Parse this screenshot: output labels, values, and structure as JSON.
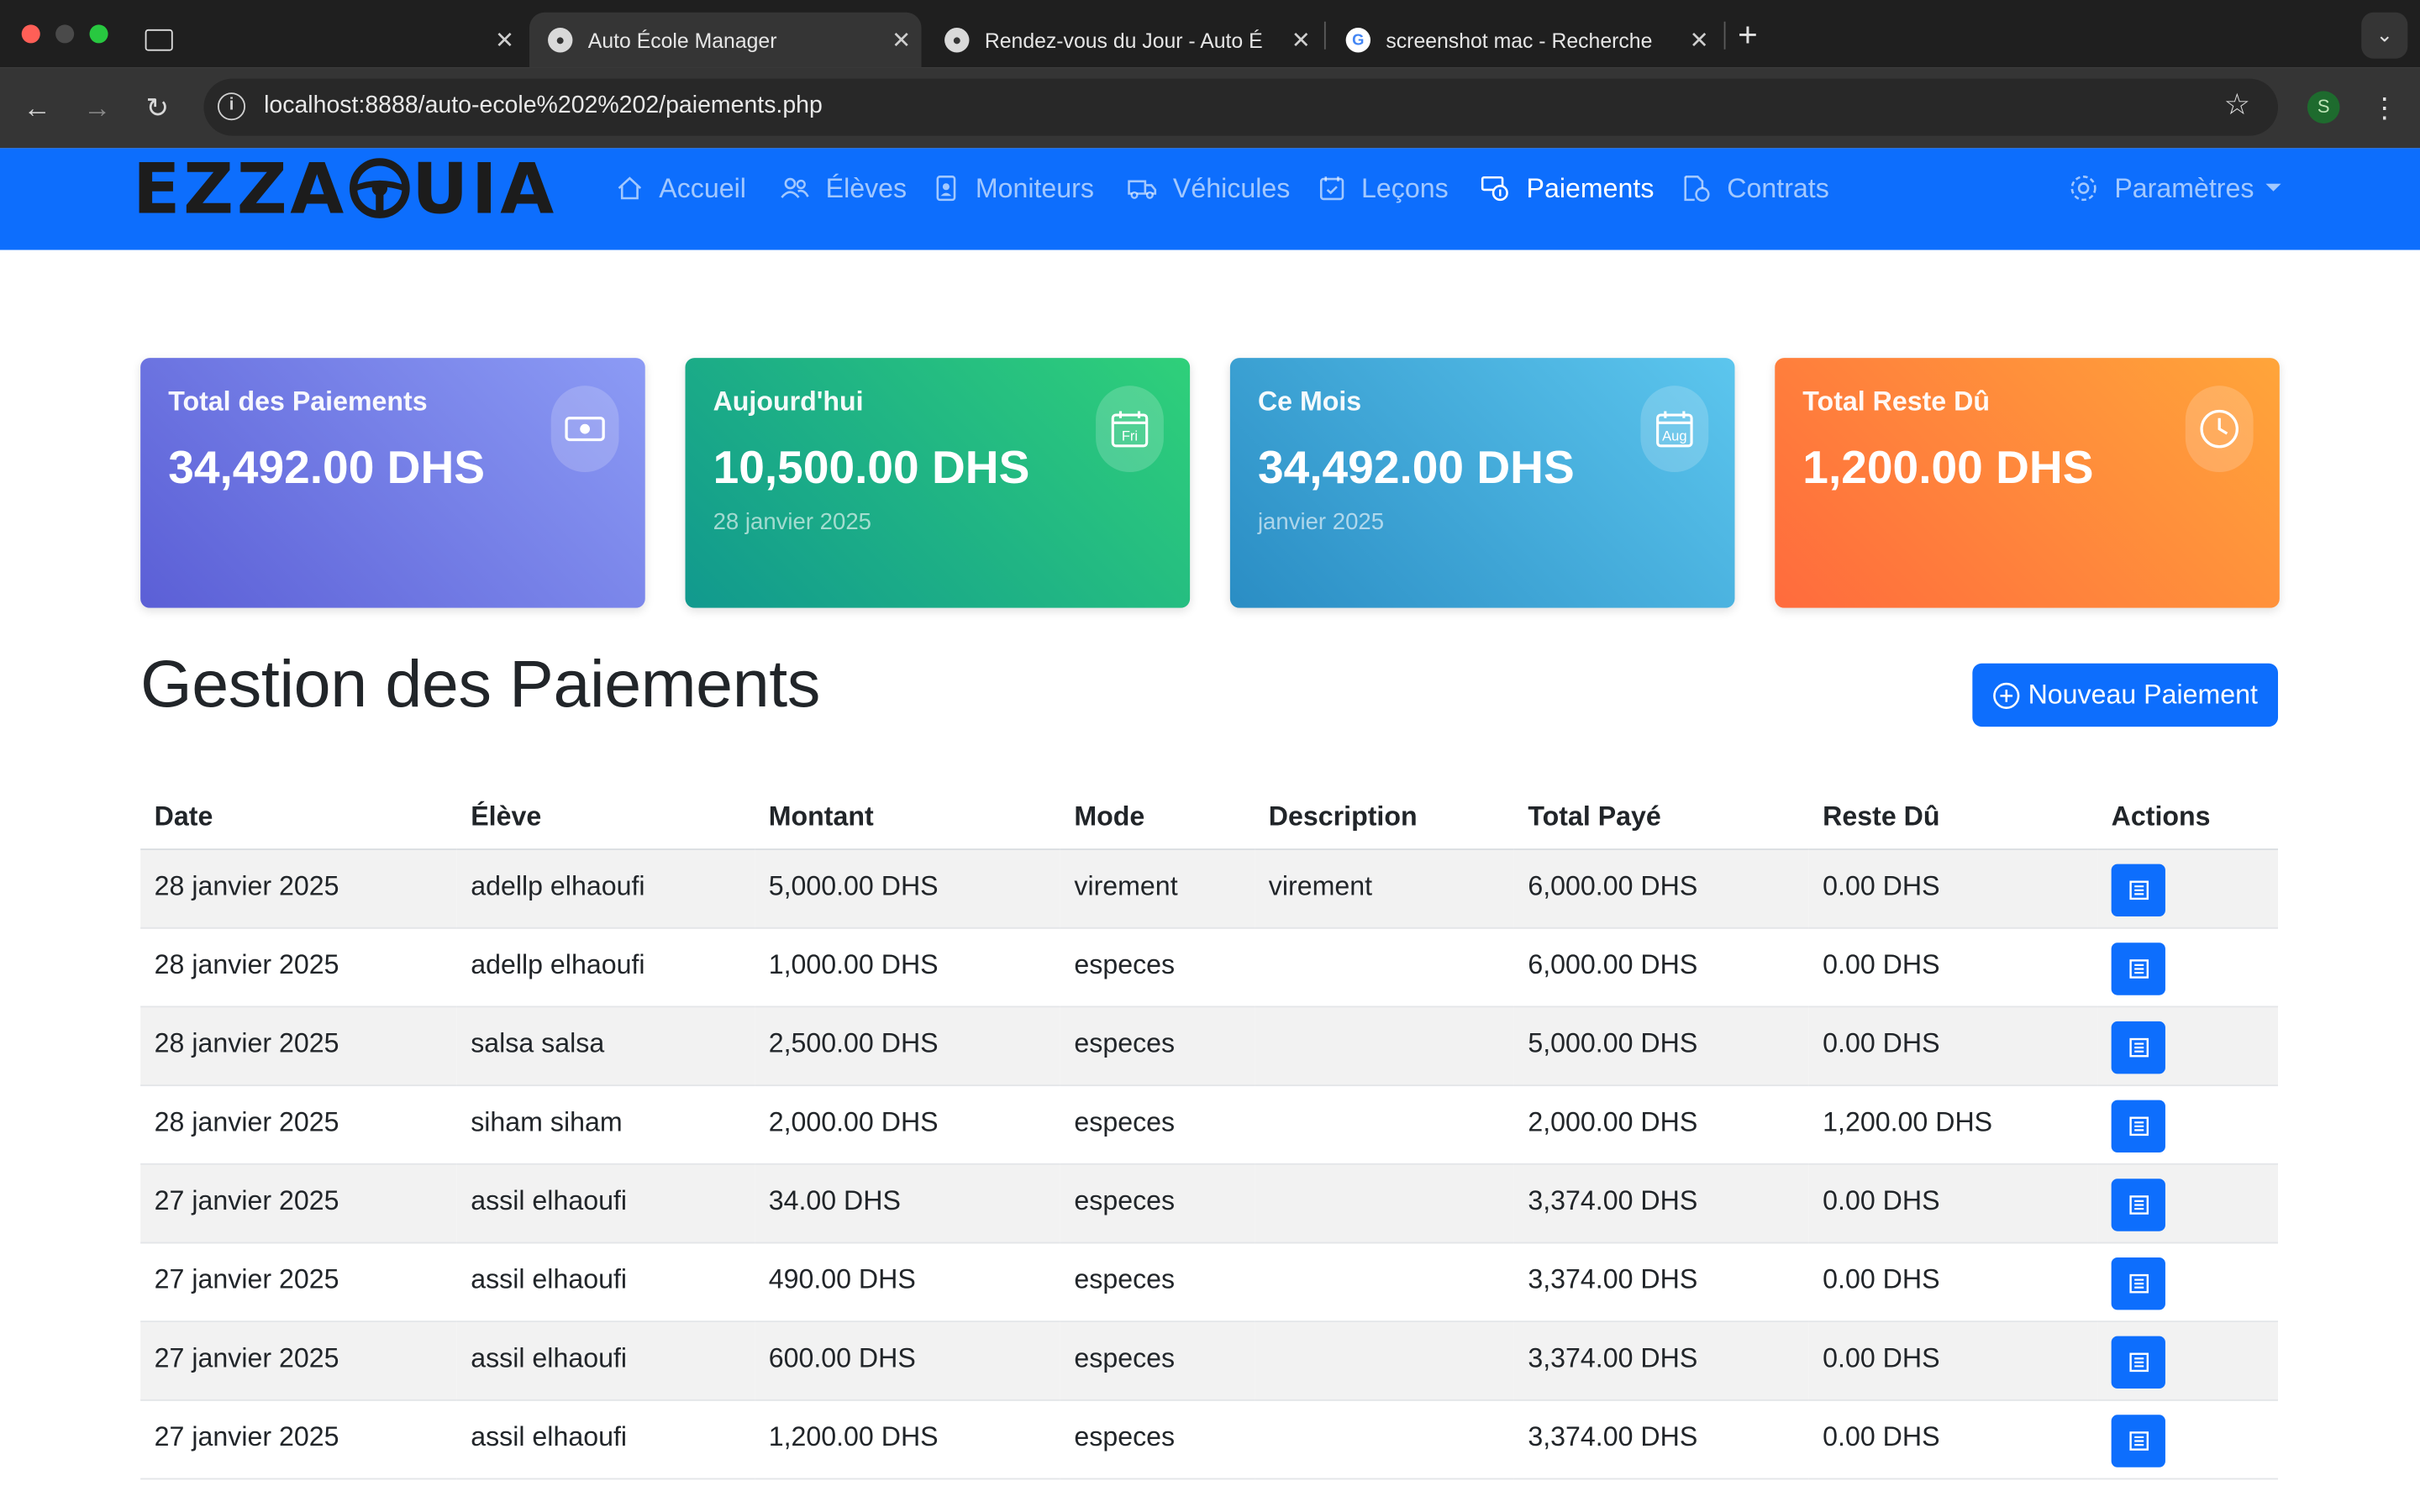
{
  "browser": {
    "tabs": [
      {
        "title": "Auto École Manager",
        "active": true
      },
      {
        "title": "Rendez-vous du Jour - Auto É",
        "active": false
      },
      {
        "title": "screenshot mac - Recherche",
        "active": false
      }
    ],
    "new_tab_glyph": "+",
    "url": "localhost:8888/auto-ecole%202%202/paiements.php",
    "profile_initial": "S"
  },
  "navbar": {
    "brand": {
      "left": "EZZA",
      "right": "UIA"
    },
    "items": [
      {
        "label": "Accueil",
        "icon": "home-icon"
      },
      {
        "label": "Élèves",
        "icon": "people-icon"
      },
      {
        "label": "Moniteurs",
        "icon": "badge-icon"
      },
      {
        "label": "Véhicules",
        "icon": "truck-icon"
      },
      {
        "label": "Leçons",
        "icon": "calendar-check-icon"
      },
      {
        "label": "Paiements",
        "icon": "cash-coin-icon",
        "active": true
      },
      {
        "label": "Contrats",
        "icon": "file-contract-icon"
      }
    ],
    "settings": {
      "label": "Paramètres",
      "icon": "gear-icon"
    }
  },
  "stats": [
    {
      "title": "Total des Paiements",
      "value": "34,492.00 DHS",
      "subtitle": "",
      "icon": "cash-icon",
      "gradient": [
        "#5b5fd6",
        "#8c9bf5"
      ]
    },
    {
      "title": "Aujourd'hui",
      "value": "10,500.00 DHS",
      "subtitle": "28 janvier 2025",
      "icon": "calendar-icon",
      "icon_text": "Fri",
      "gradient": [
        "#11998e",
        "#2fd07a"
      ]
    },
    {
      "title": "Ce Mois",
      "value": "34,492.00 DHS",
      "subtitle": "janvier 2025",
      "icon": "calendar-icon",
      "icon_text": "Aug",
      "gradient": [
        "#2a8dc4",
        "#5cc6ee"
      ]
    },
    {
      "title": "Total Reste Dû",
      "value": "1,200.00 DHS",
      "subtitle": "",
      "icon": "clock-icon",
      "gradient": [
        "#ff6b3d",
        "#ffa53a"
      ]
    }
  ],
  "page": {
    "title": "Gestion des Paiements",
    "new_button": "Nouveau Paiement"
  },
  "table": {
    "headers": [
      "Date",
      "Élève",
      "Montant",
      "Mode",
      "Description",
      "Total Payé",
      "Reste Dû",
      "Actions"
    ],
    "rows": [
      [
        "28 janvier 2025",
        "adellp elhaoufi",
        "5,000.00 DHS",
        "virement",
        "virement",
        "6,000.00 DHS",
        "0.00 DHS"
      ],
      [
        "28 janvier 2025",
        "adellp elhaoufi",
        "1,000.00 DHS",
        "especes",
        "",
        "6,000.00 DHS",
        "0.00 DHS"
      ],
      [
        "28 janvier 2025",
        "salsa salsa",
        "2,500.00 DHS",
        "especes",
        "",
        "5,000.00 DHS",
        "0.00 DHS"
      ],
      [
        "28 janvier 2025",
        "siham siham",
        "2,000.00 DHS",
        "especes",
        "",
        "2,000.00 DHS",
        "1,200.00 DHS"
      ],
      [
        "27 janvier 2025",
        "assil elhaoufi",
        "34.00 DHS",
        "especes",
        "",
        "3,374.00 DHS",
        "0.00 DHS"
      ],
      [
        "27 janvier 2025",
        "assil elhaoufi",
        "490.00 DHS",
        "especes",
        "",
        "3,374.00 DHS",
        "0.00 DHS"
      ],
      [
        "27 janvier 2025",
        "assil elhaoufi",
        "600.00 DHS",
        "especes",
        "",
        "3,374.00 DHS",
        "0.00 DHS"
      ],
      [
        "27 janvier 2025",
        "assil elhaoufi",
        "1,200.00 DHS",
        "especes",
        "",
        "3,374.00 DHS",
        "0.00 DHS"
      ]
    ],
    "action_icon": "receipt-icon"
  },
  "colors": {
    "primary": "#0d6efd",
    "chrome_dark": "#1f1f1f",
    "chrome_toolbar": "#353535"
  }
}
